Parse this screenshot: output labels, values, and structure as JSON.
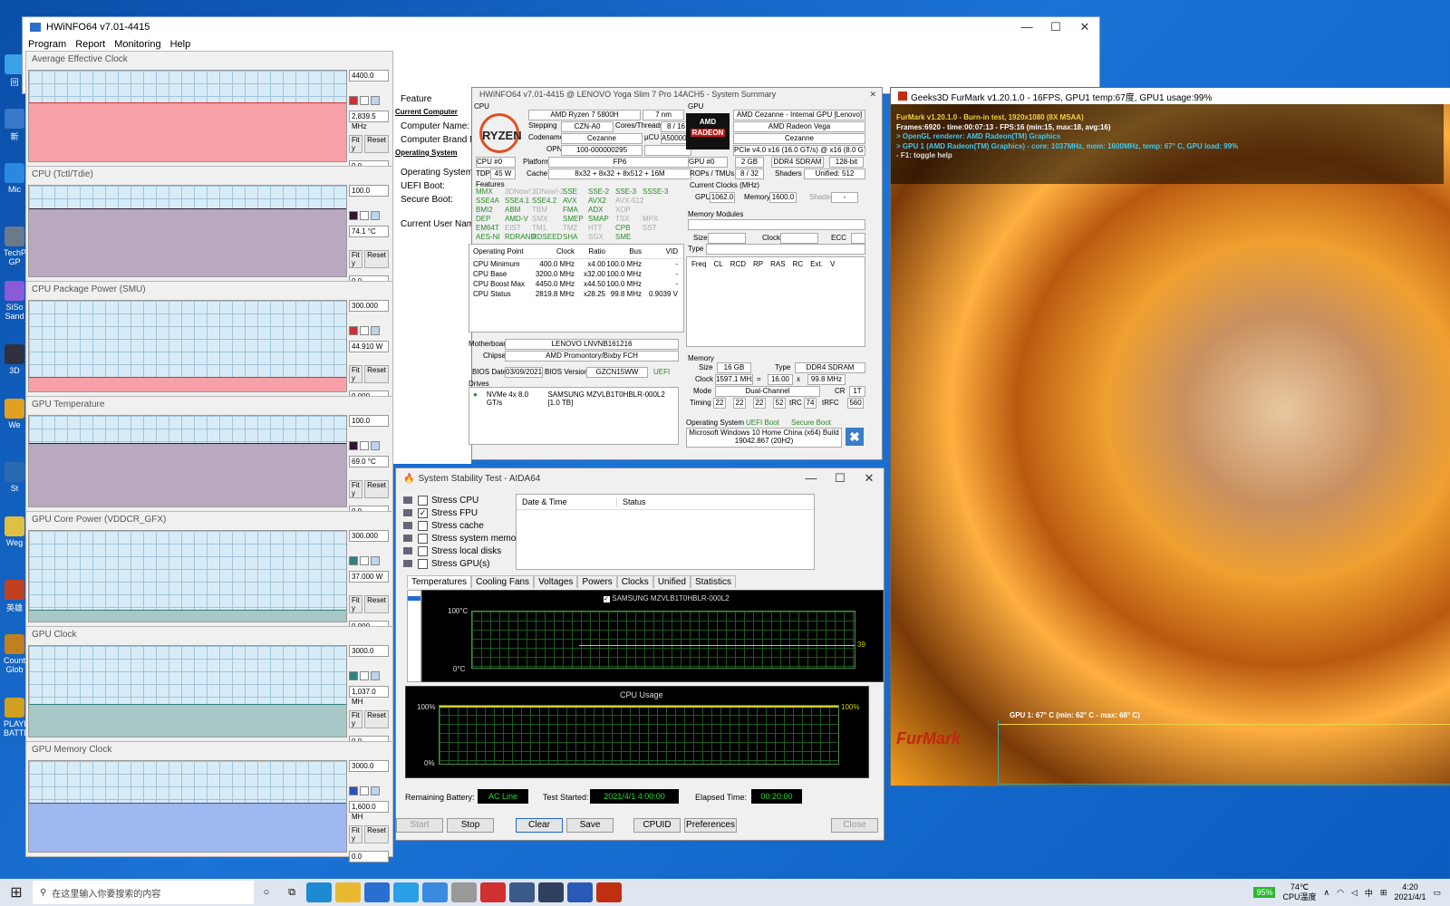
{
  "desktop": {
    "icons": [
      "回",
      "新",
      "Mic",
      "TechP GP",
      "SiSo Sand",
      "3D",
      "We",
      "St",
      "Weg",
      "英雄",
      "Count Glob",
      "PLAYE BATTL"
    ]
  },
  "hwinfo_main": {
    "title": "HWiNFO64 v7.01-4415",
    "menu": [
      "Program",
      "Report",
      "Monitoring",
      "Help"
    ],
    "tree": [
      {
        "label": "Feature",
        "bold": false
      },
      {
        "label": "Current Computer",
        "bold": true
      },
      {
        "label": "Computer Name:",
        "bold": false
      },
      {
        "label": "Computer Brand N",
        "bold": false
      },
      {
        "label": "Operating System",
        "bold": true
      },
      {
        "label": "Operating System:",
        "bold": false
      },
      {
        "label": "UEFI Boot:",
        "bold": false
      },
      {
        "label": "Secure Boot:",
        "bold": false
      },
      {
        "label": "Current User Name:",
        "bold": false
      }
    ],
    "drives_node": "Drives"
  },
  "sensors": [
    {
      "title": "Average Effective Clock",
      "max": "4400.0",
      "current": "2,839.5 MHz",
      "min": "0.0",
      "color": "#f7a0a8",
      "fill_color": "#d03030",
      "level": 0.64
    },
    {
      "title": "CPU (Tctl/Tdie)",
      "max": "100.0",
      "current": "74.1 °C",
      "min": "0.0",
      "color": "#b8a8c0",
      "fill_color": "#301830",
      "level": 0.74
    },
    {
      "title": "CPU Package Power (SMU)",
      "max": "300.000",
      "current": "44.910 W",
      "min": "0.000",
      "color": "#f7a0a8",
      "fill_color": "#d03030",
      "level": 0.15
    },
    {
      "title": "GPU Temperature",
      "max": "100.0",
      "current": "69.0 °C",
      "min": "0.0",
      "color": "#b8a8c0",
      "fill_color": "#301830",
      "level": 0.69
    },
    {
      "title": "GPU Core Power (VDDCR_GFX)",
      "max": "300.000",
      "current": "37.000 W",
      "min": "0.000",
      "color": "#a8c8c8",
      "fill_color": "#308080",
      "level": 0.12
    },
    {
      "title": "GPU Clock",
      "max": "3000.0",
      "current": "1,037.0 MH",
      "min": "0.0",
      "color": "#a8c8c8",
      "fill_color": "#308080",
      "level": 0.35
    },
    {
      "title": "GPU Memory Clock",
      "max": "3000.0",
      "current": "1,600.0 MH",
      "min": "0.0",
      "color": "#a0b8f0",
      "fill_color": "#3050c0",
      "level": 0.53
    }
  ],
  "sensor_buttons": {
    "fit": "Fit y",
    "reset": "Reset"
  },
  "summary": {
    "title": "HWiNFO64 v7.01-4415 @ LENOVO Yoga Slim 7 Pro 14ACH5 - System Summary",
    "cpu_label": "CPU",
    "cpu_name": "AMD Ryzen 7 5800H",
    "process": "7 nm",
    "stepping_label": "Stepping",
    "stepping": "CZN-A0",
    "cores_label": "Cores/Threads",
    "cores": "8 / 16",
    "codename_label": "Codename",
    "codename": "Cezanne",
    "ucu_label": "µCU",
    "ucu": "A50000B",
    "opn_label": "OPN",
    "opn": "100-000000295",
    "cpu_select": "CPU #0",
    "platform_label": "Platform",
    "platform": "FP6",
    "tdp_label": "TDP",
    "tdp": "45 W",
    "cache_label": "Cache",
    "cache": "8x32 + 8x32 + 8x512 + 16M",
    "features_label": "Features",
    "features": [
      {
        "t": "MMX",
        "on": true
      },
      {
        "t": "3DNow!",
        "on": false
      },
      {
        "t": "3DNow!-2",
        "on": false
      },
      {
        "t": "SSE",
        "on": true
      },
      {
        "t": "SSE-2",
        "on": true
      },
      {
        "t": "SSE-3",
        "on": true
      },
      {
        "t": "SSSE-3",
        "on": true
      },
      {
        "t": "SSE4A",
        "on": true
      },
      {
        "t": "SSE4.1",
        "on": true
      },
      {
        "t": "SSE4.2",
        "on": true
      },
      {
        "t": "AVX",
        "on": true
      },
      {
        "t": "AVX2",
        "on": true
      },
      {
        "t": "AVX-512",
        "on": false
      },
      {
        "t": "BMI2",
        "on": true
      },
      {
        "t": "ABM",
        "on": true
      },
      {
        "t": "TBM",
        "on": false
      },
      {
        "t": "FMA",
        "on": true
      },
      {
        "t": "ADX",
        "on": true
      },
      {
        "t": "XOP",
        "on": false
      },
      {
        "t": "DEP",
        "on": true
      },
      {
        "t": "AMD-V",
        "on": true
      },
      {
        "t": "SMX",
        "on": false
      },
      {
        "t": "SMEP",
        "on": true
      },
      {
        "t": "SMAP",
        "on": true
      },
      {
        "t": "TSX",
        "on": false
      },
      {
        "t": "MPX",
        "on": false
      },
      {
        "t": "EM64T",
        "on": true
      },
      {
        "t": "EIST",
        "on": false
      },
      {
        "t": "TM1",
        "on": false
      },
      {
        "t": "TM2",
        "on": false
      },
      {
        "t": "HTT",
        "on": false
      },
      {
        "t": "CPB",
        "on": true
      },
      {
        "t": "SST",
        "on": false
      },
      {
        "t": "AES-NI",
        "on": true
      },
      {
        "t": "RDRAND",
        "on": true
      },
      {
        "t": "RDSEED",
        "on": true
      },
      {
        "t": "SHA",
        "on": true
      },
      {
        "t": "SGX",
        "on": false
      },
      {
        "t": "SME",
        "on": true
      }
    ],
    "op_headers": [
      "Operating Point",
      "Clock",
      "Ratio",
      "Bus",
      "VID"
    ],
    "op_rows": [
      [
        "CPU Minimum",
        "400.0 MHz",
        "x4.00",
        "100.0 MHz",
        "-"
      ],
      [
        "CPU Base",
        "3200.0 MHz",
        "x32.00",
        "100.0 MHz",
        "-"
      ],
      [
        "CPU Boost Max",
        "4450.0 MHz",
        "x44.50",
        "100.0 MHz",
        "-"
      ],
      [
        "CPU Status",
        "2819.8 MHz",
        "x28.25",
        "99.8 MHz",
        "0.9039 V"
      ]
    ],
    "mb_label": "Motherboard",
    "motherboard": "LENOVO LNVNB161216",
    "chipset_label": "Chipset",
    "chipset": "AMD Promontory/Bixby FCH",
    "bios_date_label": "BIOS Date",
    "bios_date": "03/09/2021",
    "bios_ver_label": "BIOS Version",
    "bios_ver": "GZCN15WW",
    "uefi": "UEFI",
    "drives_label": "Drives",
    "drive_iface": "NVMe 4x 8.0 GT/s",
    "drive_name": "SAMSUNG MZVLB1T0HBLR-000L2 [1.0 TB]",
    "gpu_label": "GPU",
    "gpu_name": "AMD Cezanne - Internal GPU [Lenovo]",
    "gpu_model": "AMD Radeon Vega",
    "gpu_code": "Cezanne",
    "gpu_bus": "PCIe v4.0 x16 (16.0 GT/s) @ x16 (8.0 GT/s)",
    "gpu_select": "GPU #0",
    "gpu_mem": "2 GB",
    "gpu_memtype": "DDR4 SDRAM",
    "gpu_bits": "128-bit",
    "rops_label": "ROPs / TMUs",
    "rops": "8 / 32",
    "shaders_label": "Shaders",
    "shaders": "Unified: 512",
    "clocks_label": "Current Clocks (MHz)",
    "gpu_clk_label": "GPU",
    "gpu_clk": "1062.0",
    "mem_clk_label": "Memory",
    "mem_clk": "1600.0",
    "shader_label": "Shader",
    "shader_clk": "-",
    "modules_label": "Memory Modules",
    "size_label": "Size",
    "clock_label": "Clock",
    "ecc_label": "ECC",
    "type_label": "Type",
    "timing_headers": [
      "Freq",
      "CL",
      "RCD",
      "RP",
      "RAS",
      "RC",
      "Ext.",
      "V"
    ],
    "memory_label": "Memory",
    "mem_size": "16 GB",
    "mem_type_label": "Type",
    "mem_type": "DDR4 SDRAM",
    "mem_clock_label": "Clock",
    "mem_clock": "1597.1 MHz",
    "eq": "=",
    "mult": "16.00",
    "x": "x",
    "mem_bus": "99.8 MHz",
    "mode_label": "Mode",
    "mode": "Dual-Channel",
    "cr_label": "CR",
    "cr": "1T",
    "timing_label": "Timing",
    "timings": [
      "22",
      "22",
      "22",
      "52"
    ],
    "trc_label": "tRC",
    "trc": "74",
    "trfc_label": "tRFC",
    "trfc": "560",
    "os_label": "Operating System",
    "uefi_boot": "UEFI Boot",
    "secure_boot": "Secure Boot",
    "os_name": "Microsoft Windows 10 Home China (x64) Build 19042.867 (20H2)"
  },
  "aida": {
    "title": "System Stability Test - AIDA64",
    "checks": [
      {
        "label": "Stress CPU",
        "checked": false
      },
      {
        "label": "Stress FPU",
        "checked": true
      },
      {
        "label": "Stress cache",
        "checked": false
      },
      {
        "label": "Stress system memory",
        "checked": false
      },
      {
        "label": "Stress local disks",
        "checked": false
      },
      {
        "label": "Stress GPU(s)",
        "checked": false
      }
    ],
    "table_headers": [
      "Date & Time",
      "Status"
    ],
    "tabs": [
      "Temperatures",
      "Cooling Fans",
      "Voltages",
      "Powers",
      "Clocks",
      "Unified",
      "Statistics"
    ],
    "temp_legend": "SAMSUNG MZVLB1T0HBLR-000L2",
    "temp_top": "100°C",
    "temp_bottom": "0°C",
    "temp_value": "39",
    "cpu_usage_title": "CPU Usage",
    "usage_top": "100%",
    "usage_bottom": "0%",
    "usage_value": "100%",
    "battery_label": "Remaining Battery:",
    "battery": "AC Line",
    "started_label": "Test Started:",
    "started": "2021/4/1 4:00:00",
    "elapsed_label": "Elapsed Time:",
    "elapsed": "00:20:00",
    "buttons": [
      "Start",
      "Stop",
      "Clear",
      "Save",
      "CPUID",
      "Preferences",
      "Close"
    ]
  },
  "furmark": {
    "title": "Geeks3D FurMark v1.20.1.0 - 16FPS, GPU1 temp:67度, GPU1 usage:99%",
    "lines": [
      "FurMark v1.20.1.0 - Burn-in test, 1920x1080 (8X MSAA)",
      "Frames:6920 - time:00:07:13 - FPS:16 (min:15, max:18, avg:16)",
      "> OpenGL renderer: AMD Radeon(TM) Graphics",
      "> GPU 1 (AMD Radeon(TM) Graphics) - core: 1037MHz, mem: 1600MHz, temp: 67° C, GPU load: 99%",
      "- F1: toggle help"
    ],
    "gpu_line": "GPU 1: 67° C (min: 62° C - max: 68° C)",
    "logo": "FurMark"
  },
  "taskbar": {
    "search_placeholder": "在这里输入你要搜索的内容",
    "battery": "95%",
    "temp": "74℃",
    "temp_label": "CPU温度",
    "ime": "中",
    "time": "4:20",
    "date": "2021/4/1"
  }
}
